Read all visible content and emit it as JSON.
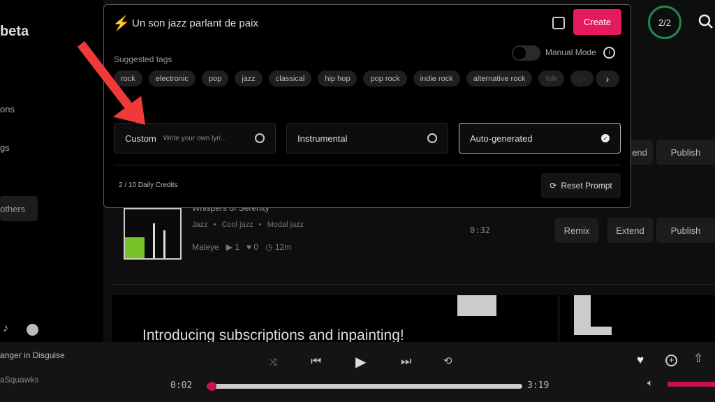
{
  "sidebar": {
    "brand": "beta",
    "items": [
      "ons",
      "gs"
    ],
    "others_button": "others",
    "social_icons": [
      "tiktok-icon",
      "reddit-icon"
    ]
  },
  "header": {
    "credits_ring": "2/2",
    "ring_color": "#1f8a4c"
  },
  "prompt": {
    "value": "Un son jazz parlant de paix",
    "create_label": "Create",
    "create_color": "#e5195e",
    "suggested_tags_label": "Suggested tags",
    "manual_mode_label": "Manual Mode",
    "manual_mode_on": false,
    "tags": [
      "rock",
      "electronic",
      "pop",
      "jazz",
      "classical",
      "hip hop",
      "pop rock",
      "indie rock",
      "alternative rock",
      "folk",
      "pu"
    ],
    "lyrics_options": [
      {
        "label": "Custom",
        "hint": "Write your own lyri...",
        "selected": false
      },
      {
        "label": "Instrumental",
        "selected": false
      },
      {
        "label": "Auto-generated",
        "selected": true
      }
    ],
    "daily_credits": "2 / 10 Daily Credits",
    "reset_label": "Reset Prompt"
  },
  "songs": [
    {
      "title": "",
      "actions": [
        "end",
        "Publish"
      ]
    },
    {
      "title": "Whispers of Serenity",
      "tags": [
        "Jazz",
        "Cool jazz",
        "Modal jazz"
      ],
      "author": "Maleye",
      "plays": "1",
      "likes": "0",
      "age": "12m",
      "duration": "0:32",
      "actions": [
        "Remix",
        "Extend",
        "Publish"
      ]
    }
  ],
  "banner": {
    "text": "Introducing subscriptions and inpainting!"
  },
  "player": {
    "title": "anger in Disguise",
    "artist": "aSquawks",
    "elapsed": "0:02",
    "total": "3:19",
    "progress": 0.01,
    "accent": "#e5195e"
  }
}
